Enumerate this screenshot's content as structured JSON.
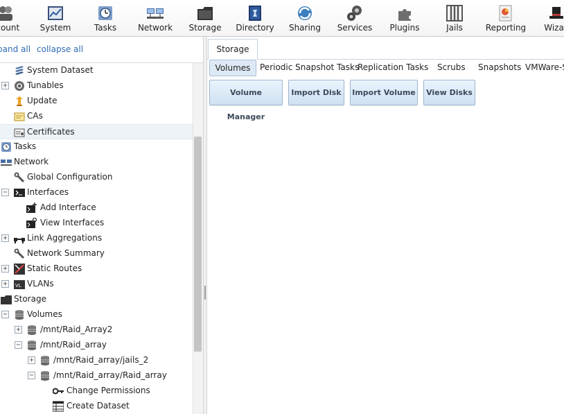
{
  "toolbar": {
    "items": [
      {
        "label": "ccount",
        "icon": "account-icon"
      },
      {
        "label": "System",
        "icon": "system-icon"
      },
      {
        "label": "Tasks",
        "icon": "tasks-icon"
      },
      {
        "label": "Network",
        "icon": "network-icon"
      },
      {
        "label": "Storage",
        "icon": "storage-icon"
      },
      {
        "label": "Directory",
        "icon": "directory-icon"
      },
      {
        "label": "Sharing",
        "icon": "sharing-icon"
      },
      {
        "label": "Services",
        "icon": "services-icon"
      },
      {
        "label": "Plugins",
        "icon": "plugins-icon"
      },
      {
        "label": "Jails",
        "icon": "jails-icon"
      },
      {
        "label": "Reporting",
        "icon": "reporting-icon"
      },
      {
        "label": "Wizar",
        "icon": "wizard-icon"
      }
    ]
  },
  "tree_controls": {
    "expand_all": "pand all",
    "collapse_all": "collapse all"
  },
  "tree": [
    {
      "label": "System Dataset",
      "icon": "dataset-icon",
      "expander": ""
    },
    {
      "label": "Tunables",
      "icon": "tunables-icon",
      "expander": "+"
    },
    {
      "label": "Update",
      "icon": "update-icon",
      "expander": ""
    },
    {
      "label": "CAs",
      "icon": "ca-icon",
      "expander": ""
    },
    {
      "label": "Certificates",
      "icon": "certificate-icon",
      "expander": "",
      "selected": true
    },
    {
      "label": "Tasks",
      "icon": "tasks-icon",
      "expander": ""
    },
    {
      "label": "Network",
      "icon": "network-icon",
      "expander": ""
    },
    {
      "label": "Global Configuration",
      "icon": "wrench-icon",
      "expander": ""
    },
    {
      "label": "Interfaces",
      "icon": "interfaces-icon",
      "expander": "−"
    },
    {
      "label": "Add Interface",
      "icon": "add-interface-icon",
      "expander": ""
    },
    {
      "label": "View Interfaces",
      "icon": "view-interfaces-icon",
      "expander": ""
    },
    {
      "label": "Link Aggregations",
      "icon": "link-aggregation-icon",
      "expander": "+"
    },
    {
      "label": "Network Summary",
      "icon": "wrench-icon",
      "expander": ""
    },
    {
      "label": "Static Routes",
      "icon": "static-routes-icon",
      "expander": "+"
    },
    {
      "label": "VLANs",
      "icon": "vlan-icon",
      "expander": "+"
    },
    {
      "label": "Storage",
      "icon": "storage-icon",
      "expander": ""
    },
    {
      "label": "Volumes",
      "icon": "volume-icon",
      "expander": "−"
    },
    {
      "label": "/mnt/Raid_Array2",
      "icon": "volume-icon",
      "expander": "+"
    },
    {
      "label": "/mnt/Raid_array",
      "icon": "volume-icon",
      "expander": "−"
    },
    {
      "label": "/mnt/Raid_array/jails_2",
      "icon": "volume-icon",
      "expander": "+"
    },
    {
      "label": "/mnt/Raid_array/Raid_array",
      "icon": "volume-icon",
      "expander": "−"
    },
    {
      "label": "Change Permissions",
      "icon": "key-icon",
      "expander": ""
    },
    {
      "label": "Create Dataset",
      "icon": "create-dataset-icon",
      "expander": ""
    }
  ],
  "main": {
    "outer_tab": "Storage",
    "inner_tabs": [
      "Volumes",
      "Periodic Snapshot Tasks",
      "Replication Tasks",
      "Scrubs",
      "Snapshots",
      "VMWare-S"
    ],
    "buttons": [
      "Volume Manager",
      "Import Disk",
      "Import Volume",
      "View Disks"
    ]
  }
}
